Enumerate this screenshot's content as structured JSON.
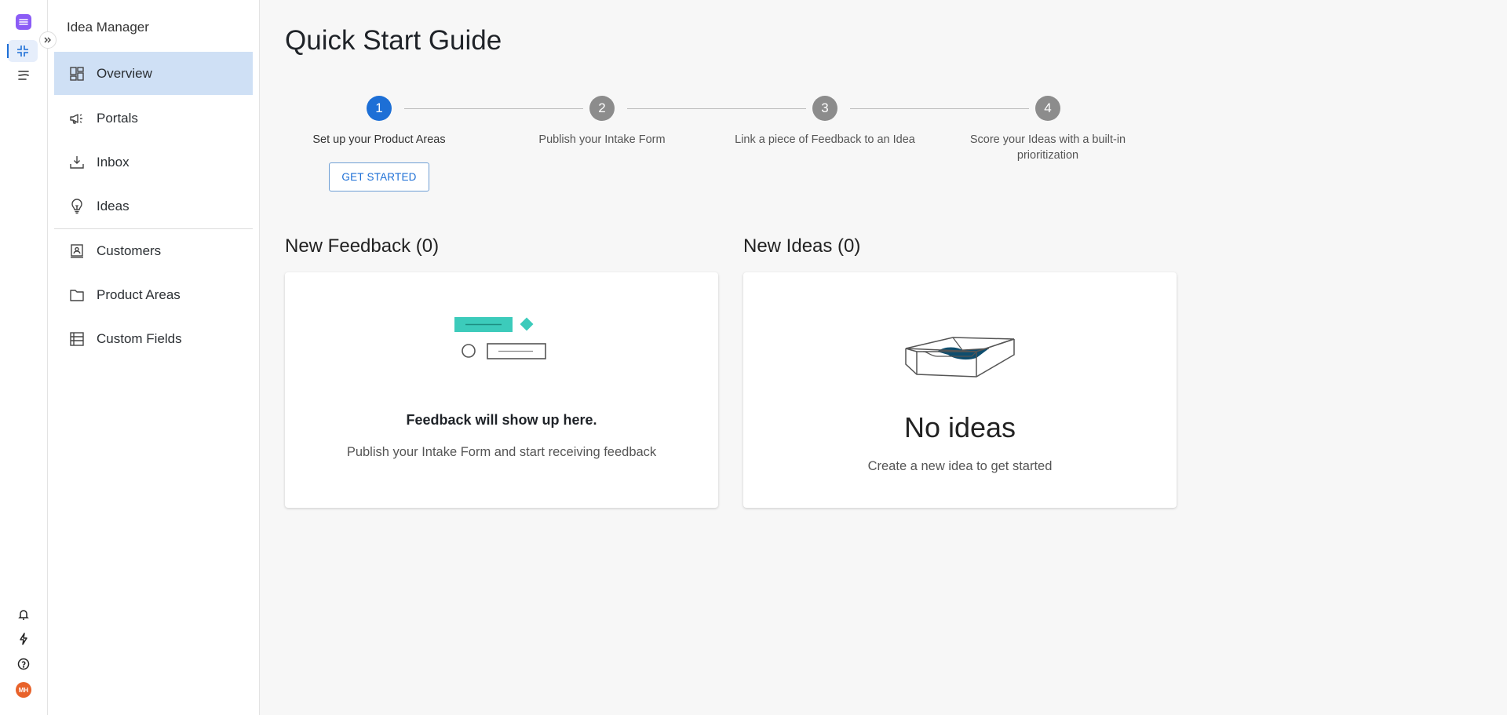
{
  "rail": {
    "logo_icon": "app-logo-icon",
    "items": [
      "idea-manager-icon",
      "roadmap-icon"
    ],
    "bottom": [
      "bell-icon",
      "lightning-icon",
      "help-icon"
    ],
    "avatar_initials": "MH",
    "avatar_color": "#e8622a"
  },
  "sidebar": {
    "title": "Idea Manager",
    "items": [
      {
        "label": "Overview",
        "icon": "overview-icon",
        "active": true
      },
      {
        "label": "Portals",
        "icon": "megaphone-icon"
      },
      {
        "label": "Inbox",
        "icon": "inbox-icon"
      },
      {
        "label": "Ideas",
        "icon": "lightbulb-icon"
      },
      {
        "label": "Customers",
        "icon": "customers-icon"
      },
      {
        "label": "Product Areas",
        "icon": "folder-icon"
      },
      {
        "label": "Custom Fields",
        "icon": "custom-fields-icon"
      }
    ]
  },
  "main": {
    "title": "Quick Start Guide",
    "steps": [
      {
        "number": "1",
        "label": "Set up your Product Areas",
        "button": "GET STARTED"
      },
      {
        "number": "2",
        "label": "Publish your Intake Form"
      },
      {
        "number": "3",
        "label": "Link a piece of Feedback to an Idea"
      },
      {
        "number": "4",
        "label": "Score your Ideas with a built-in prioritization"
      }
    ],
    "feedback": {
      "title": "New Feedback (0)",
      "headline": "Feedback will show up here.",
      "sub": "Publish your Intake Form and start receiving feedback"
    },
    "ideas": {
      "title": "New Ideas (0)",
      "headline": "No ideas",
      "sub": "Create a new idea to get started"
    }
  },
  "colors": {
    "accent": "#1d6fd6",
    "active_nav": "#cfe0f5",
    "brand": "#8b5cf6",
    "illustration_teal": "#3ccbbb",
    "tray_blue": "#0f4e6e"
  }
}
